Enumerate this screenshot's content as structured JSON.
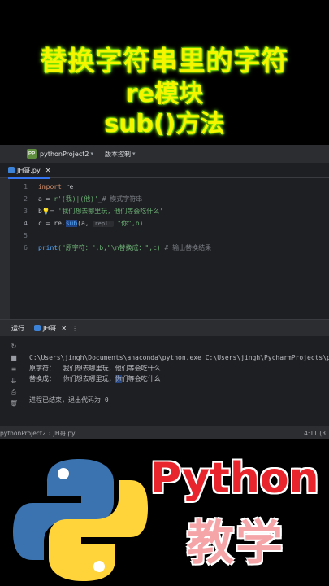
{
  "banner": {
    "line1": "替换字符串里的字符",
    "line2": "re模块",
    "line3": "sub()方法"
  },
  "ide": {
    "project_badge": "PP",
    "project_name": "pythonProject2",
    "vcs_label": "版本控制",
    "file_tab": "JH哥.py",
    "line_numbers": [
      "1",
      "2",
      "3",
      "4",
      "5",
      "6"
    ],
    "code": {
      "l1_kw": "import",
      "l1_rest": " re",
      "l2_var": "a = ",
      "l2_str": "r'(我)|(他)'",
      "l2_cm": "_# 模式字符串",
      "l3_var": "b",
      "l3_mid": "= ",
      "l3_str": "'我们想去哪里玩，他们等会吃什么'",
      "l4_a": "c = re.",
      "l4_fn": "sub",
      "l4_b": "(a, ",
      "l4_hint": "repl:",
      "l4_c": " \"你\",b)",
      "l6_fn": "print",
      "l6_a": "(\"原字符：\",b,\"\\n替换成：\",c)",
      "l6_cm": " # 输出替换结果"
    },
    "cursor_glyph": "I",
    "run_label": "运行",
    "run_tab": "JH哥",
    "console": {
      "cmd": "C:\\Users\\jingh\\Documents\\anaconda\\python.exe C:\\Users\\jingh\\PycharmProjects\\p",
      "out1": "原字符：  我们想去哪里玩，他们等会吃什么",
      "out2_a": "替换成：  你们想去哪里玩，",
      "out2_hl": "你",
      "out2_b": "们等会吃什么",
      "exit": "进程已结束，退出代码为 0"
    },
    "status": {
      "project": "pythonProject2",
      "file": "JH哥.py",
      "position": "4:11 (3"
    }
  },
  "brand": {
    "line1": "Python",
    "line2": "教学"
  },
  "colors": {
    "banner_text": "#f5f500",
    "brand_red": "#e8242c",
    "python_blue": "#3a73b0",
    "python_yellow": "#ffd43b"
  }
}
